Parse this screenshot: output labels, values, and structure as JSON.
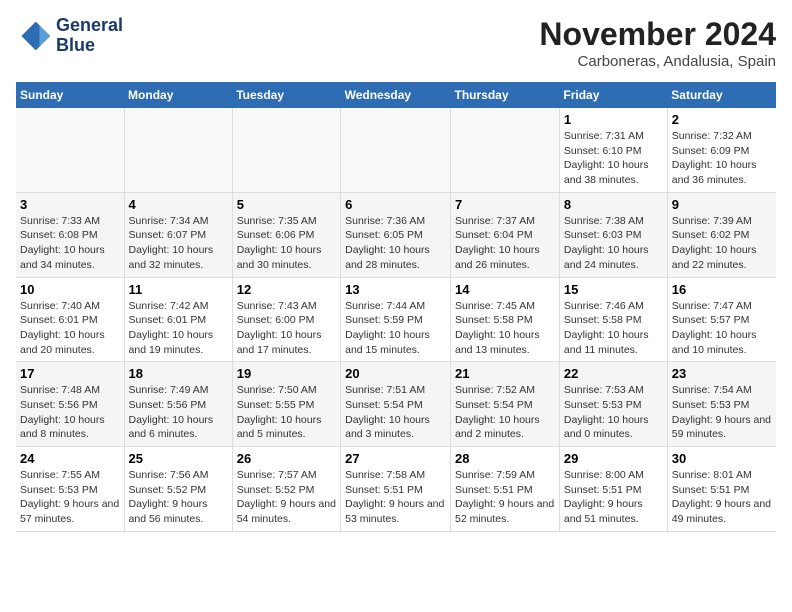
{
  "header": {
    "logo_line1": "General",
    "logo_line2": "Blue",
    "month": "November 2024",
    "location": "Carboneras, Andalusia, Spain"
  },
  "weekdays": [
    "Sunday",
    "Monday",
    "Tuesday",
    "Wednesday",
    "Thursday",
    "Friday",
    "Saturday"
  ],
  "weeks": [
    [
      {
        "day": "",
        "info": ""
      },
      {
        "day": "",
        "info": ""
      },
      {
        "day": "",
        "info": ""
      },
      {
        "day": "",
        "info": ""
      },
      {
        "day": "",
        "info": ""
      },
      {
        "day": "1",
        "info": "Sunrise: 7:31 AM\nSunset: 6:10 PM\nDaylight: 10 hours and 38 minutes."
      },
      {
        "day": "2",
        "info": "Sunrise: 7:32 AM\nSunset: 6:09 PM\nDaylight: 10 hours and 36 minutes."
      }
    ],
    [
      {
        "day": "3",
        "info": "Sunrise: 7:33 AM\nSunset: 6:08 PM\nDaylight: 10 hours and 34 minutes."
      },
      {
        "day": "4",
        "info": "Sunrise: 7:34 AM\nSunset: 6:07 PM\nDaylight: 10 hours and 32 minutes."
      },
      {
        "day": "5",
        "info": "Sunrise: 7:35 AM\nSunset: 6:06 PM\nDaylight: 10 hours and 30 minutes."
      },
      {
        "day": "6",
        "info": "Sunrise: 7:36 AM\nSunset: 6:05 PM\nDaylight: 10 hours and 28 minutes."
      },
      {
        "day": "7",
        "info": "Sunrise: 7:37 AM\nSunset: 6:04 PM\nDaylight: 10 hours and 26 minutes."
      },
      {
        "day": "8",
        "info": "Sunrise: 7:38 AM\nSunset: 6:03 PM\nDaylight: 10 hours and 24 minutes."
      },
      {
        "day": "9",
        "info": "Sunrise: 7:39 AM\nSunset: 6:02 PM\nDaylight: 10 hours and 22 minutes."
      }
    ],
    [
      {
        "day": "10",
        "info": "Sunrise: 7:40 AM\nSunset: 6:01 PM\nDaylight: 10 hours and 20 minutes."
      },
      {
        "day": "11",
        "info": "Sunrise: 7:42 AM\nSunset: 6:01 PM\nDaylight: 10 hours and 19 minutes."
      },
      {
        "day": "12",
        "info": "Sunrise: 7:43 AM\nSunset: 6:00 PM\nDaylight: 10 hours and 17 minutes."
      },
      {
        "day": "13",
        "info": "Sunrise: 7:44 AM\nSunset: 5:59 PM\nDaylight: 10 hours and 15 minutes."
      },
      {
        "day": "14",
        "info": "Sunrise: 7:45 AM\nSunset: 5:58 PM\nDaylight: 10 hours and 13 minutes."
      },
      {
        "day": "15",
        "info": "Sunrise: 7:46 AM\nSunset: 5:58 PM\nDaylight: 10 hours and 11 minutes."
      },
      {
        "day": "16",
        "info": "Sunrise: 7:47 AM\nSunset: 5:57 PM\nDaylight: 10 hours and 10 minutes."
      }
    ],
    [
      {
        "day": "17",
        "info": "Sunrise: 7:48 AM\nSunset: 5:56 PM\nDaylight: 10 hours and 8 minutes."
      },
      {
        "day": "18",
        "info": "Sunrise: 7:49 AM\nSunset: 5:56 PM\nDaylight: 10 hours and 6 minutes."
      },
      {
        "day": "19",
        "info": "Sunrise: 7:50 AM\nSunset: 5:55 PM\nDaylight: 10 hours and 5 minutes."
      },
      {
        "day": "20",
        "info": "Sunrise: 7:51 AM\nSunset: 5:54 PM\nDaylight: 10 hours and 3 minutes."
      },
      {
        "day": "21",
        "info": "Sunrise: 7:52 AM\nSunset: 5:54 PM\nDaylight: 10 hours and 2 minutes."
      },
      {
        "day": "22",
        "info": "Sunrise: 7:53 AM\nSunset: 5:53 PM\nDaylight: 10 hours and 0 minutes."
      },
      {
        "day": "23",
        "info": "Sunrise: 7:54 AM\nSunset: 5:53 PM\nDaylight: 9 hours and 59 minutes."
      }
    ],
    [
      {
        "day": "24",
        "info": "Sunrise: 7:55 AM\nSunset: 5:53 PM\nDaylight: 9 hours and 57 minutes."
      },
      {
        "day": "25",
        "info": "Sunrise: 7:56 AM\nSunset: 5:52 PM\nDaylight: 9 hours and 56 minutes."
      },
      {
        "day": "26",
        "info": "Sunrise: 7:57 AM\nSunset: 5:52 PM\nDaylight: 9 hours and 54 minutes."
      },
      {
        "day": "27",
        "info": "Sunrise: 7:58 AM\nSunset: 5:51 PM\nDaylight: 9 hours and 53 minutes."
      },
      {
        "day": "28",
        "info": "Sunrise: 7:59 AM\nSunset: 5:51 PM\nDaylight: 9 hours and 52 minutes."
      },
      {
        "day": "29",
        "info": "Sunrise: 8:00 AM\nSunset: 5:51 PM\nDaylight: 9 hours and 51 minutes."
      },
      {
        "day": "30",
        "info": "Sunrise: 8:01 AM\nSunset: 5:51 PM\nDaylight: 9 hours and 49 minutes."
      }
    ]
  ]
}
